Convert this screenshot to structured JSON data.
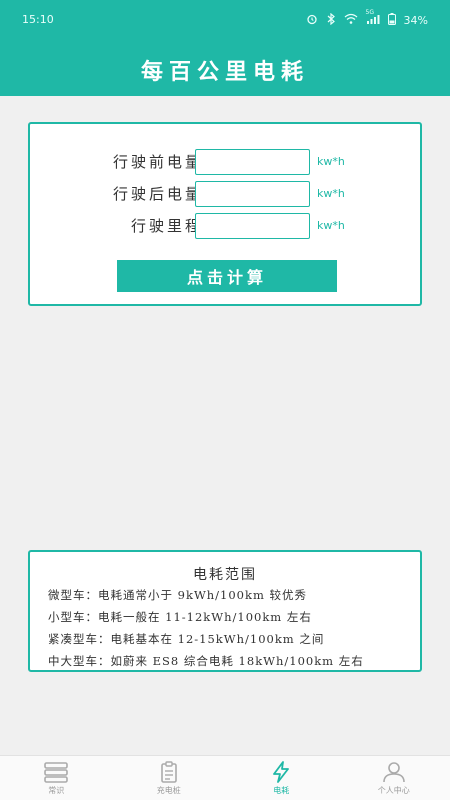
{
  "status_bar": {
    "time": "15:10",
    "network": "5G",
    "battery": "34%",
    "icons": [
      "alarm-icon",
      "bluetooth-icon",
      "wifi-icon",
      "signal-icon",
      "battery-icon"
    ]
  },
  "header": {
    "title": "每百公里电耗"
  },
  "form": {
    "fields": [
      {
        "label": "行驶前电量",
        "value": "",
        "unit": "kw*h"
      },
      {
        "label": "行驶后电量",
        "value": "",
        "unit": "kw*h"
      },
      {
        "label": "行驶里程",
        "value": "",
        "unit": "kw*h"
      }
    ],
    "submit_label": "点击计算"
  },
  "range_info": {
    "title": "电耗范围",
    "lines": [
      "微型车：电耗通常小于 9kWh/100km 较优秀",
      "小型车：电耗一般在 11-12kWh/100km 左右",
      "紧凑型车：电耗基本在 12-15kWh/100km 之间",
      "中大型车：如蔚来 ES8 综合电耗 18kWh/100km 左右"
    ]
  },
  "tabbar": {
    "tabs": [
      {
        "label": "常识",
        "icon": "book-stack-icon",
        "active": false
      },
      {
        "label": "充电桩",
        "icon": "clipboard-icon",
        "active": false
      },
      {
        "label": "电耗",
        "icon": "lightning-icon",
        "active": true
      },
      {
        "label": "个人中心",
        "icon": "person-icon",
        "active": false
      }
    ]
  },
  "colors": {
    "accent": "#1fb8a6",
    "background": "#f0f0f0"
  }
}
